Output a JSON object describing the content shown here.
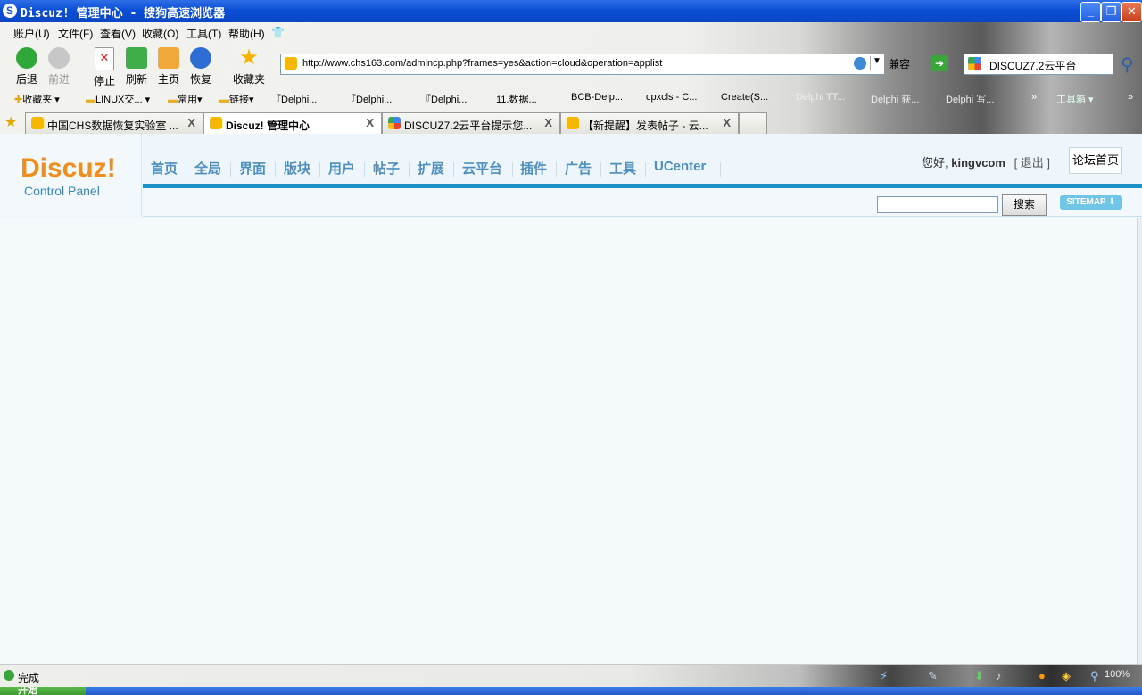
{
  "window": {
    "title": "Discuz! 管理中心 - 搜狗高速浏览器",
    "app_glyph": "S",
    "min": "_",
    "max": "❐",
    "close": "✕"
  },
  "menu": [
    "账户(U)",
    "文件(F)",
    "查看(V)",
    "收藏(O)",
    "工具(T)",
    "帮助(H)"
  ],
  "toolbar": {
    "back": "后退",
    "forward": "前进",
    "stop": "停止",
    "refresh": "刷新",
    "home": "主页",
    "restore": "恢复",
    "favorites": "收藏夹"
  },
  "address": {
    "url": "http://www.chs163.com/admincp.php?frames=yes&action=cloud&operation=applist",
    "compat": "兼容"
  },
  "search": {
    "value": "DISCUZ7.2云平台"
  },
  "favbar": [
    "收藏夹",
    "LINUX交...",
    "常用",
    "链接",
    "『Delphi...",
    "『Delphi...",
    "『Delphi...",
    "11.数据...",
    "BCB-Delp...",
    "cpxcls - C...",
    "Create(S...",
    "Delphi TT...",
    "Delphi 获...",
    "Delphi 写...",
    "工具箱"
  ],
  "tabs": [
    {
      "title": "中国CHS数据恢复实验室 ...",
      "close": "X"
    },
    {
      "title": "Discuz! 管理中心",
      "close": "X"
    },
    {
      "title": "DISCUZ7.2云平台提示您...",
      "close": "X"
    },
    {
      "title": "【新提醒】发表帖子 - 云...",
      "close": "X"
    }
  ],
  "admin": {
    "logo_main": "Discuz!",
    "logo_sub": "Control Panel",
    "nav": [
      "首页",
      "全局",
      "界面",
      "版块",
      "用户",
      "帖子",
      "扩展",
      "云平台",
      "插件",
      "广告",
      "工具",
      "UCenter"
    ],
    "greeting": "您好,",
    "username": "kingvcom",
    "logout": "[ 退出 ]",
    "forum_home": "论坛首页",
    "search_button": "搜索",
    "sitemap": "SITEMAP ⬇"
  },
  "status": {
    "text": "完成",
    "zoom": "100%"
  },
  "taskbar": {
    "start": "开始"
  },
  "colors": {
    "accent": "#1b93c9",
    "nav_text": "#4d8fbd",
    "logo_orange": "#f08e1d"
  }
}
